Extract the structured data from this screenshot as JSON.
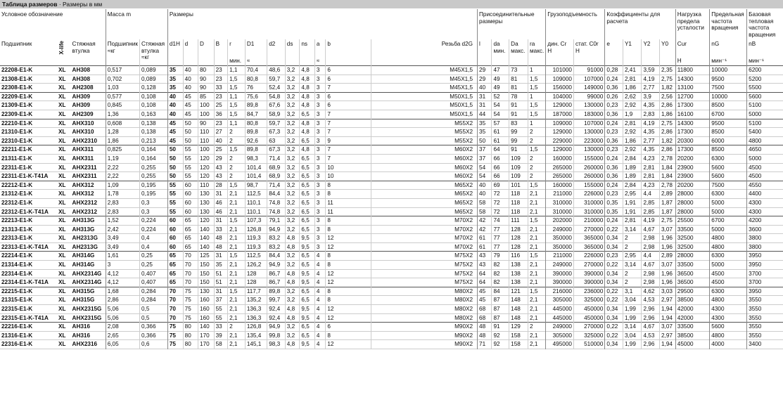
{
  "title": {
    "bold": "Таблица размеров",
    "rest": " · Размеры в мм"
  },
  "groups": {
    "designation": "Условное обозначение",
    "mass": "Масса m",
    "dims": "Размеры",
    "mount": "Присоединительные размеры",
    "load": "Грузоподъемность",
    "coef": "Коэффициенты для расчета",
    "fatigue": "Нагрузка предела усталости",
    "speed": "Предельная частота вращения",
    "thermal": "Базовая тепловая частота вращения"
  },
  "cols": {
    "bearing": "Подшипник",
    "xlife": "X-life",
    "sleeve": "Стяжная втулка",
    "m_bearing": "Подшипник",
    "m_bearing_unit": "≈кг",
    "m_sleeve": "Стяжная втулка",
    "m_sleeve_unit": "≈кг",
    "d1H": "d1H",
    "d": "d",
    "D": "D",
    "B": "B",
    "r": "r",
    "r_unit": "мин.",
    "D1": "D1",
    "D1_unit": "≈",
    "d2": "d2",
    "ds": "ds",
    "ns": "ns",
    "a": "a",
    "a_unit": "≈",
    "b": "b",
    "thread": "Резьба d2G",
    "l": "l",
    "da": "da",
    "da_unit": "мин.",
    "Da": "Da",
    "Da_unit": "макс.",
    "ra": "ra",
    "ra_unit": "макс.",
    "Cr": "дин. Cr",
    "Cr_unit": "Н",
    "C0r": "стат. C0r",
    "C0r_unit": "Н",
    "e": "e",
    "Y1": "Y1",
    "Y2": "Y2",
    "Y0": "Y0",
    "Cur": "Cur",
    "Cur_unit": "Н",
    "nG": "nG",
    "nG_unit": "мин⁻¹",
    "nB": "nB",
    "nB_unit": "мин⁻¹"
  },
  "rows": [
    [
      "22208-E1-K",
      "XL",
      "AH308",
      "0,517",
      "0,089",
      "35",
      "40",
      "80",
      "23",
      "1,1",
      "70,4",
      "48,6",
      "3,2",
      "4,8",
      "3",
      "6",
      "M45X1,5",
      "29",
      "47",
      "73",
      "1",
      "101000",
      "91000",
      "0,28",
      "2,41",
      "3,59",
      "2,35",
      "11800",
      "10000",
      "6200"
    ],
    [
      "21308-E1-K",
      "XL",
      "AH308",
      "0,702",
      "0,089",
      "35",
      "40",
      "90",
      "23",
      "1,5",
      "80,8",
      "59,7",
      "3,2",
      "4,8",
      "3",
      "6",
      "M45X1,5",
      "29",
      "49",
      "81",
      "1,5",
      "109000",
      "107000",
      "0,24",
      "2,81",
      "4,19",
      "2,75",
      "14300",
      "9500",
      "5200"
    ],
    [
      "22308-E1-K",
      "XL",
      "AH2308",
      "1,03",
      "0,128",
      "35",
      "40",
      "90",
      "33",
      "1,5",
      "76",
      "52,4",
      "3,2",
      "4,8",
      "3",
      "7",
      "M45X1,5",
      "40",
      "49",
      "81",
      "1,5",
      "156000",
      "149000",
      "0,36",
      "1,86",
      "2,77",
      "1,82",
      "13100",
      "7500",
      "5500"
    ],
    [
      "22209-E1-K",
      "XL",
      "AH309",
      "0,577",
      "0,108",
      "40",
      "45",
      "85",
      "23",
      "1,1",
      "75,6",
      "54,8",
      "3,2",
      "4,8",
      "3",
      "6",
      "M50X1,5",
      "31",
      "52",
      "78",
      "1",
      "104000",
      "99000",
      "0,26",
      "2,62",
      "3,9",
      "2,56",
      "12700",
      "10000",
      "5600"
    ],
    [
      "21309-E1-K",
      "XL",
      "AH309",
      "0,845",
      "0,108",
      "40",
      "45",
      "100",
      "25",
      "1,5",
      "89,8",
      "67,6",
      "3,2",
      "4,8",
      "3",
      "6",
      "M50X1,5",
      "31",
      "54",
      "91",
      "1,5",
      "129000",
      "130000",
      "0,23",
      "2,92",
      "4,35",
      "2,86",
      "17300",
      "8500",
      "5100"
    ],
    [
      "22309-E1-K",
      "XL",
      "AH2309",
      "1,36",
      "0,163",
      "40",
      "45",
      "100",
      "36",
      "1,5",
      "84,7",
      "58,9",
      "3,2",
      "6,5",
      "3",
      "7",
      "M50X1,5",
      "44",
      "54",
      "91",
      "1,5",
      "187000",
      "183000",
      "0,36",
      "1,9",
      "2,83",
      "1,86",
      "16100",
      "6700",
      "5000"
    ],
    [
      "22210-E1-K",
      "XL",
      "AHX310",
      "0,608",
      "0,138",
      "45",
      "50",
      "90",
      "23",
      "1,1",
      "80,8",
      "59,7",
      "3,2",
      "4,8",
      "3",
      "7",
      "M55X2",
      "35",
      "57",
      "83",
      "1",
      "109000",
      "107000",
      "0,24",
      "2,81",
      "4,19",
      "2,75",
      "14300",
      "9500",
      "5100"
    ],
    [
      "21310-E1-K",
      "XL",
      "AHX310",
      "1,28",
      "0,138",
      "45",
      "50",
      "110",
      "27",
      "2",
      "89,8",
      "67,3",
      "3,2",
      "4,8",
      "3",
      "7",
      "M55X2",
      "35",
      "61",
      "99",
      "2",
      "129000",
      "130000",
      "0,23",
      "2,92",
      "4,35",
      "2,86",
      "17300",
      "8500",
      "5400"
    ],
    [
      "22310-E1-K",
      "XL",
      "AHX2310",
      "1,86",
      "0,213",
      "45",
      "50",
      "110",
      "40",
      "2",
      "92,6",
      "63",
      "3,2",
      "6,5",
      "3",
      "9",
      "M55X2",
      "50",
      "61",
      "99",
      "2",
      "229000",
      "223000",
      "0,36",
      "1,86",
      "2,77",
      "1,82",
      "20300",
      "6000",
      "4800"
    ],
    [
      "22211-E1-K",
      "XL",
      "AHX311",
      "0,825",
      "0,164",
      "50",
      "55",
      "100",
      "25",
      "1,5",
      "89,8",
      "67,3",
      "3,2",
      "4,8",
      "3",
      "7",
      "M60X2",
      "37",
      "64",
      "91",
      "1,5",
      "129000",
      "130000",
      "0,23",
      "2,92",
      "4,35",
      "2,86",
      "17300",
      "8500",
      "4650"
    ],
    [
      "21311-E1-K",
      "XL",
      "AHX311",
      "1,19",
      "0,164",
      "50",
      "55",
      "120",
      "29",
      "2",
      "98,3",
      "71,4",
      "3,2",
      "6,5",
      "3",
      "7",
      "M60X2",
      "37",
      "66",
      "109",
      "2",
      "160000",
      "155000",
      "0,24",
      "2,84",
      "4,23",
      "2,78",
      "20200",
      "6300",
      "5000"
    ],
    [
      "22311-E1-K",
      "XL",
      "AHX2311",
      "2,22",
      "0,255",
      "50",
      "55",
      "120",
      "43",
      "2",
      "101,4",
      "68,9",
      "3,2",
      "6,5",
      "3",
      "10",
      "M60X2",
      "54",
      "66",
      "109",
      "2",
      "265000",
      "260000",
      "0,36",
      "1,89",
      "2,81",
      "1,84",
      "23900",
      "5600",
      "4500"
    ],
    [
      "22311-E1-K-T41A",
      "XL",
      "AHX2311",
      "2,22",
      "0,255",
      "50",
      "55",
      "120",
      "43",
      "2",
      "101,4",
      "68,9",
      "3,2",
      "6,5",
      "3",
      "10",
      "M60X2",
      "54",
      "66",
      "109",
      "2",
      "265000",
      "260000",
      "0,36",
      "1,89",
      "2,81",
      "1,84",
      "23900",
      "5600",
      "4500"
    ],
    [
      "22212-E1-K",
      "XL",
      "AHX312",
      "1,09",
      "0,195",
      "55",
      "60",
      "110",
      "28",
      "1,5",
      "98,7",
      "71,4",
      "3,2",
      "6,5",
      "3",
      "8",
      "M65X2",
      "40",
      "69",
      "101",
      "1,5",
      "160000",
      "155000",
      "0,24",
      "2,84",
      "4,23",
      "2,78",
      "20200",
      "7500",
      "4550"
    ],
    [
      "21312-E1-K",
      "XL",
      "AHX312",
      "1,78",
      "0,195",
      "55",
      "60",
      "130",
      "31",
      "2,1",
      "112,5",
      "84,4",
      "3,2",
      "6,5",
      "3",
      "8",
      "M65X2",
      "40",
      "72",
      "118",
      "2,1",
      "211000",
      "226000",
      "0,23",
      "2,95",
      "4,4",
      "2,89",
      "28000",
      "6300",
      "4400"
    ],
    [
      "22312-E1-K",
      "XL",
      "AHX2312",
      "2,83",
      "0,3",
      "55",
      "60",
      "130",
      "46",
      "2,1",
      "110,1",
      "74,8",
      "3,2",
      "6,5",
      "3",
      "11",
      "M65X2",
      "58",
      "72",
      "118",
      "2,1",
      "310000",
      "310000",
      "0,35",
      "1,91",
      "2,85",
      "1,87",
      "28000",
      "5000",
      "4300"
    ],
    [
      "22312-E1-K-T41A",
      "XL",
      "AHX2312",
      "2,83",
      "0,3",
      "55",
      "60",
      "130",
      "46",
      "2,1",
      "110,1",
      "74,8",
      "3,2",
      "6,5",
      "3",
      "11",
      "M65X2",
      "58",
      "72",
      "118",
      "2,1",
      "310000",
      "310000",
      "0,35",
      "1,91",
      "2,85",
      "1,87",
      "28000",
      "5000",
      "4300"
    ],
    [
      "22213-E1-K",
      "XL",
      "AH313G",
      "1,52",
      "0,224",
      "60",
      "65",
      "120",
      "31",
      "1,5",
      "107,3",
      "79,1",
      "3,2",
      "6,5",
      "3",
      "8",
      "M70X2",
      "42",
      "74",
      "111",
      "1,5",
      "202000",
      "210000",
      "0,24",
      "2,81",
      "4,19",
      "2,75",
      "25500",
      "6700",
      "4200"
    ],
    [
      "21313-E1-K",
      "XL",
      "AH313G",
      "2,42",
      "0,224",
      "60",
      "65",
      "140",
      "33",
      "2,1",
      "126,8",
      "94,9",
      "3,2",
      "6,5",
      "3",
      "8",
      "M70X2",
      "42",
      "77",
      "128",
      "2,1",
      "249000",
      "270000",
      "0,22",
      "3,14",
      "4,67",
      "3,07",
      "33500",
      "5000",
      "3600"
    ],
    [
      "22313-E1-K",
      "XL",
      "AH2313G",
      "3,49",
      "0,4",
      "60",
      "65",
      "140",
      "48",
      "2,1",
      "119,3",
      "83,2",
      "4,8",
      "9,5",
      "3",
      "12",
      "M70X2",
      "61",
      "77",
      "128",
      "2,1",
      "350000",
      "365000",
      "0,34",
      "2",
      "2,98",
      "1,96",
      "32500",
      "4800",
      "3800"
    ],
    [
      "22313-E1-K-T41A",
      "XL",
      "AH2313G",
      "3,49",
      "0,4",
      "60",
      "65",
      "140",
      "48",
      "2,1",
      "119,3",
      "83,2",
      "4,8",
      "9,5",
      "3",
      "12",
      "M70X2",
      "61",
      "77",
      "128",
      "2,1",
      "350000",
      "365000",
      "0,34",
      "2",
      "2,98",
      "1,96",
      "32500",
      "4800",
      "3800"
    ],
    [
      "22214-E1-K",
      "XL",
      "AH314G",
      "1,61",
      "0,25",
      "65",
      "70",
      "125",
      "31",
      "1,5",
      "112,5",
      "84,4",
      "3,2",
      "6,5",
      "4",
      "8",
      "M75X2",
      "43",
      "79",
      "116",
      "1,5",
      "211000",
      "226000",
      "0,23",
      "2,95",
      "4,4",
      "2,89",
      "28000",
      "6300",
      "3950"
    ],
    [
      "21314-E1-K",
      "XL",
      "AH314G",
      "3",
      "0,25",
      "65",
      "70",
      "150",
      "35",
      "2,1",
      "126,2",
      "94,9",
      "3,2",
      "6,5",
      "4",
      "8",
      "M75X2",
      "43",
      "82",
      "138",
      "2,1",
      "249000",
      "270000",
      "0,22",
      "3,14",
      "4,67",
      "3,07",
      "33500",
      "5000",
      "3950"
    ],
    [
      "22314-E1-K",
      "XL",
      "AHX2314G",
      "4,12",
      "0,407",
      "65",
      "70",
      "150",
      "51",
      "2,1",
      "128",
      "86,7",
      "4,8",
      "9,5",
      "4",
      "12",
      "M75X2",
      "64",
      "82",
      "138",
      "2,1",
      "390000",
      "390000",
      "0,34",
      "2",
      "2,98",
      "1,96",
      "36500",
      "4500",
      "3700"
    ],
    [
      "22314-E1-K-T41A",
      "XL",
      "AHX2314G",
      "4,12",
      "0,407",
      "65",
      "70",
      "150",
      "51",
      "2,1",
      "128",
      "86,7",
      "4,8",
      "9,5",
      "4",
      "12",
      "M75X2",
      "64",
      "82",
      "138",
      "2,1",
      "390000",
      "390000",
      "0,34",
      "2",
      "2,98",
      "1,96",
      "36500",
      "4500",
      "3700"
    ],
    [
      "22215-E1-K",
      "XL",
      "AH315G",
      "1,68",
      "0,284",
      "70",
      "75",
      "130",
      "31",
      "1,5",
      "117,7",
      "89,8",
      "3,2",
      "6,5",
      "4",
      "8",
      "M80X2",
      "45",
      "84",
      "121",
      "1,5",
      "216000",
      "236000",
      "0,22",
      "3,1",
      "4,62",
      "3,03",
      "29500",
      "6300",
      "3950"
    ],
    [
      "21315-E1-K",
      "XL",
      "AH315G",
      "2,86",
      "0,284",
      "70",
      "75",
      "160",
      "37",
      "2,1",
      "135,2",
      "99,7",
      "3,2",
      "6,5",
      "4",
      "8",
      "M80X2",
      "45",
      "87",
      "148",
      "2,1",
      "305000",
      "325000",
      "0,22",
      "3,04",
      "4,53",
      "2,97",
      "38500",
      "4800",
      "3550"
    ],
    [
      "22315-E1-K",
      "XL",
      "AHX2315G",
      "5,06",
      "0,5",
      "70",
      "75",
      "160",
      "55",
      "2,1",
      "136,3",
      "92,4",
      "4,8",
      "9,5",
      "4",
      "12",
      "M80X2",
      "68",
      "87",
      "148",
      "2,1",
      "445000",
      "450000",
      "0,34",
      "1,99",
      "2,96",
      "1,94",
      "42000",
      "4300",
      "3550"
    ],
    [
      "22315-E1-K-T41A",
      "XL",
      "AHX2315G",
      "5,06",
      "0,5",
      "70",
      "75",
      "160",
      "55",
      "2,1",
      "136,3",
      "92,4",
      "4,8",
      "9,5",
      "4",
      "12",
      "M80X2",
      "68",
      "87",
      "148",
      "2,1",
      "445000",
      "450000",
      "0,34",
      "1,99",
      "2,96",
      "1,94",
      "42000",
      "4300",
      "3550"
    ],
    [
      "22216-E1-K",
      "XL",
      "AH316",
      "2,08",
      "0,366",
      "75",
      "80",
      "140",
      "33",
      "2",
      "126,8",
      "94,9",
      "3,2",
      "6,5",
      "4",
      "6",
      "M90X2",
      "48",
      "91",
      "129",
      "2",
      "249000",
      "270000",
      "0,22",
      "3,14",
      "4,67",
      "3,07",
      "33500",
      "5600",
      "3550"
    ],
    [
      "21316-E1-K",
      "XL",
      "AH316",
      "2,65",
      "0,366",
      "75",
      "80",
      "170",
      "39",
      "2,1",
      "135,4",
      "99,8",
      "3,2",
      "6,5",
      "4",
      "8",
      "M90X2",
      "48",
      "92",
      "158",
      "2,1",
      "305000",
      "325000",
      "0,22",
      "3,04",
      "4,53",
      "2,97",
      "38500",
      "4800",
      "3550"
    ],
    [
      "22316-E1-K",
      "XL",
      "AHX2316",
      "6,05",
      "0,6",
      "75",
      "80",
      "170",
      "58",
      "2,1",
      "145,1",
      "98,3",
      "4,8",
      "9,5",
      "4",
      "12",
      "M90X2",
      "71",
      "92",
      "158",
      "2,1",
      "495000",
      "510000",
      "0,34",
      "1,99",
      "2,96",
      "1,94",
      "45000",
      "4000",
      "3400"
    ]
  ],
  "group_ends": [
    2,
    5,
    8,
    12,
    16,
    20,
    24,
    28
  ]
}
